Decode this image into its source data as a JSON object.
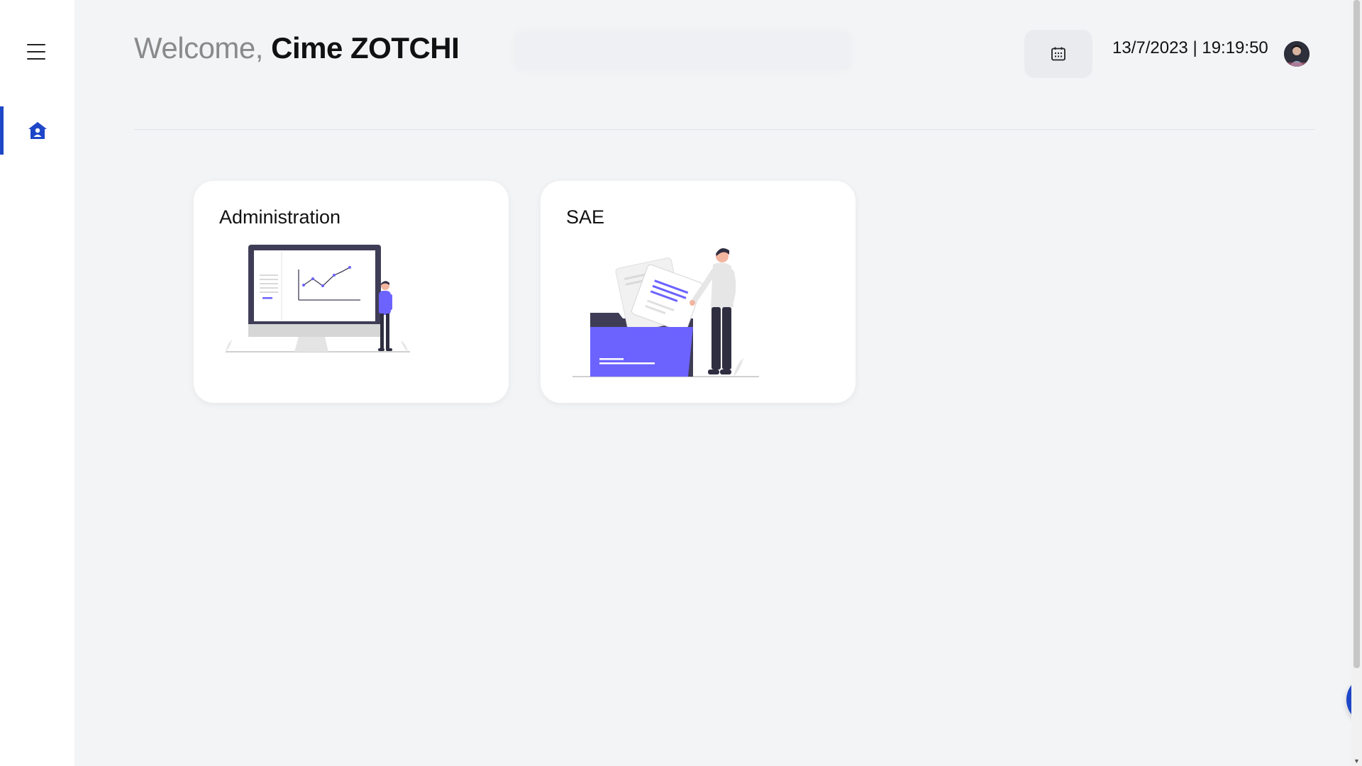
{
  "header": {
    "greeting": "Welcome,",
    "user_name": "Cime ZOTCHI",
    "datetime": "13/7/2023 | 19:19:50"
  },
  "sidebar": {
    "icons": [
      "menu-icon",
      "home-icon"
    ],
    "active_item": "home"
  },
  "cards": [
    {
      "title": "Administration",
      "illustration": "dashboard-illustration"
    },
    {
      "title": "SAE",
      "illustration": "documents-illustration"
    }
  ],
  "colors": {
    "accent": "#1e46c8",
    "illustration_accent": "#6c63ff",
    "background": "#f3f4f6"
  },
  "fab": {
    "icon": "gear-icon"
  }
}
